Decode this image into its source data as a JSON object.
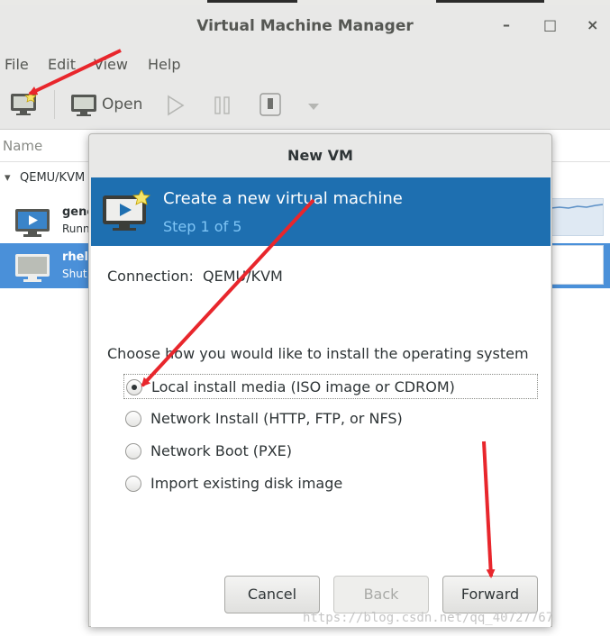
{
  "window": {
    "title": "Virtual Machine Manager",
    "minimize_glyph": "–",
    "maximize_glyph": "□",
    "close_glyph": "×"
  },
  "menu": [
    "File",
    "Edit",
    "View",
    "Help"
  ],
  "toolbar": {
    "open_label": "Open"
  },
  "list": {
    "column_name": "Name",
    "group": "QEMU/KVM",
    "expander_glyph": "▾",
    "vms": [
      {
        "name": "gene",
        "status": "Runn",
        "icon": "running-monitor-icon"
      },
      {
        "name": "rhel",
        "status": "Shut",
        "icon": "shutoff-monitor-icon"
      }
    ]
  },
  "dialog": {
    "title": "New VM",
    "banner_title": "Create a new virtual machine",
    "banner_step": "Step 1 of 5",
    "connection_label": "Connection:",
    "connection_value": "QEMU/KVM",
    "choose_prompt": "Choose how you would like to install the operating system",
    "options": [
      {
        "label": "Local install media (ISO image or CDROM)",
        "selected": true
      },
      {
        "label": "Network Install (HTTP, FTP, or NFS)",
        "selected": false
      },
      {
        "label": "Network Boot (PXE)",
        "selected": false
      },
      {
        "label": "Import existing disk image",
        "selected": false
      }
    ],
    "buttons": {
      "cancel": "Cancel",
      "back": "Back",
      "forward": "Forward"
    }
  },
  "watermark": "https://blog.csdn.net/qq_40727767",
  "colors": {
    "banner": "#1e6fb0",
    "selection": "#4a90d9",
    "annotation_arrow": "#e8262c"
  }
}
